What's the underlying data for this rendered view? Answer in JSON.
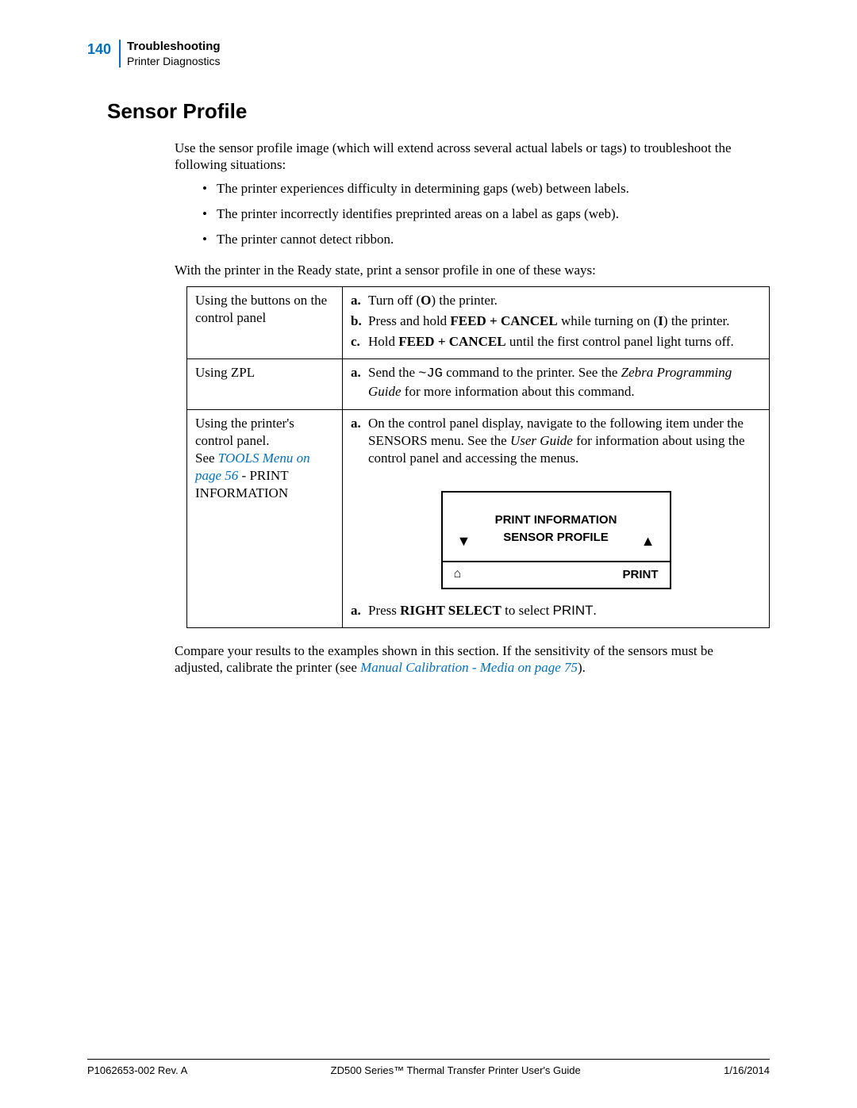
{
  "header": {
    "page_number": "140",
    "section": "Troubleshooting",
    "subsection": "Printer Diagnostics"
  },
  "title": "Sensor Profile",
  "intro": "Use the sensor profile image (which will extend across several actual labels or tags) to troubleshoot the following situations:",
  "bullets": [
    "The printer experiences difficulty in determining gaps (web) between labels.",
    "The printer incorrectly identifies preprinted areas on a label as gaps (web).",
    "The printer cannot detect ribbon."
  ],
  "lead_in": "With the printer in the Ready state, print a sensor profile in one of these ways:",
  "rows": {
    "r1": {
      "label": "Using the buttons on the control panel",
      "a": {
        "m": "a.",
        "t1": "Turn off (",
        "t2": ") the printer."
      },
      "b": {
        "m": "b.",
        "t1": "Press and hold ",
        "t2": " while turning on (",
        "t3": ") the printer."
      },
      "c": {
        "m": "c.",
        "t1": "Hold ",
        "t2": " until the first control panel light turns off."
      },
      "bold": {
        "feed_cancel": "FEED + CANCEL",
        "O": "O",
        "I": "I"
      }
    },
    "r2": {
      "label": "Using ZPL",
      "a": {
        "m": "a.",
        "t1": "Send the ",
        "cmd": "~JG",
        "t2": " command to the printer. See the ",
        "ital": "Zebra Programming Guide",
        "t3": " for more information about this command."
      }
    },
    "r3": {
      "label_line1": "Using the printer's control panel.",
      "label_line2a": "See ",
      "label_link": "TOOLS Menu",
      "label_after_link_a": " ",
      "label_link2": "on page 56",
      "label_line2b": " - PRINT INFORMATION",
      "a": {
        "m": "a.",
        "t1": "On the control panel display, navigate to the following item under the SENSORS menu. See the ",
        "ital": "User Guide",
        "t2": " for information about using the control panel and accessing the menus."
      },
      "a2": {
        "m": "a.",
        "t1": "Press ",
        "bold": "RIGHT SELECT",
        "t2": " to select ",
        "sans": "PRINT",
        "t3": "."
      }
    }
  },
  "lcd": {
    "line1": "PRINT INFORMATION",
    "line2": "SENSOR PROFILE",
    "down": "▼",
    "up": "▲",
    "home": "⌂",
    "print": "PRINT"
  },
  "outro": {
    "t1": "Compare your results to the examples shown in this section. If the sensitivity of the sensors must be adjusted, calibrate the printer (see ",
    "link": "Manual Calibration - Media",
    "on_page": " on page 75",
    "t2": ")."
  },
  "footer": {
    "left": "P1062653-002 Rev. A",
    "center": "ZD500 Series™ Thermal Transfer Printer User's Guide",
    "right": "1/16/2014"
  }
}
